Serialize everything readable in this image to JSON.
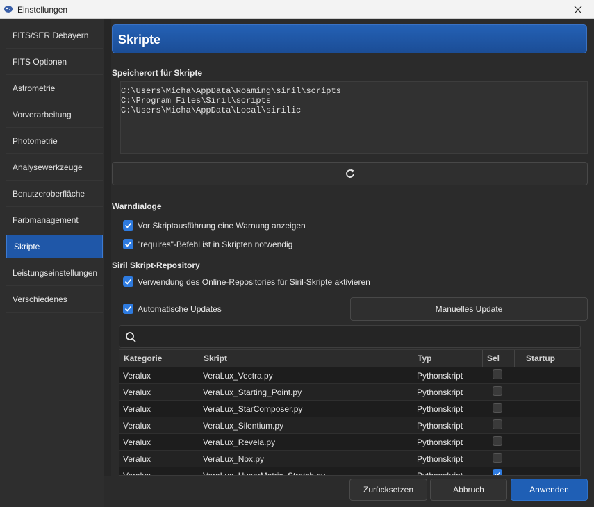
{
  "window": {
    "title": "Einstellungen",
    "app_icon": "siril-icon",
    "close_icon": "close-icon"
  },
  "sidebar": {
    "items": [
      {
        "label": "FITS/SER Debayern"
      },
      {
        "label": "FITS Optionen"
      },
      {
        "label": "Astrometrie"
      },
      {
        "label": "Vorverarbeitung"
      },
      {
        "label": "Photometrie"
      },
      {
        "label": "Analysewerkzeuge"
      },
      {
        "label": "Benutzeroberfläche"
      },
      {
        "label": "Farbmanagement"
      },
      {
        "label": "Skripte"
      },
      {
        "label": "Leistungseinstellungen"
      },
      {
        "label": "Verschiedenes"
      }
    ],
    "selected": "Skripte"
  },
  "page": {
    "header": "Skripte",
    "storage_label": "Speicherort für Skripte",
    "paths": [
      "C:\\Users\\Micha\\AppData\\Roaming\\siril\\scripts",
      "C:\\Program Files\\Siril\\scripts",
      "C:\\Users\\Micha\\AppData\\Local\\sirilic"
    ],
    "refresh_icon": "refresh-icon",
    "warn_label": "Warndialoge",
    "warn_checks": [
      {
        "label": "Vor Skriptausführung eine Warnung anzeigen",
        "checked": true
      },
      {
        "label": "\"requires\"-Befehl ist in Skripten notwendig",
        "checked": true
      }
    ],
    "repo_label": "Siril Skript-Repository",
    "repo_online": {
      "label": "Verwendung des Online-Repositories für Siril-Skripte aktivieren",
      "checked": true
    },
    "auto_updates": {
      "label": "Automatische Updates",
      "checked": true
    },
    "manual_update": "Manuelles Update",
    "search_icon": "search-icon",
    "search_value": ""
  },
  "table": {
    "columns": [
      "Kategorie",
      "Skript",
      "Typ",
      "Sel",
      "Startup"
    ],
    "rows": [
      {
        "kategorie": "Veralux",
        "skript": "VeraLux_Vectra.py",
        "typ": "Pythonskript",
        "sel": false
      },
      {
        "kategorie": "Veralux",
        "skript": "VeraLux_Starting_Point.py",
        "typ": "Pythonskript",
        "sel": false
      },
      {
        "kategorie": "Veralux",
        "skript": "VeraLux_StarComposer.py",
        "typ": "Pythonskript",
        "sel": false
      },
      {
        "kategorie": "Veralux",
        "skript": "VeraLux_Silentium.py",
        "typ": "Pythonskript",
        "sel": false
      },
      {
        "kategorie": "Veralux",
        "skript": "VeraLux_Revela.py",
        "typ": "Pythonskript",
        "sel": false
      },
      {
        "kategorie": "Veralux",
        "skript": "VeraLux_Nox.py",
        "typ": "Pythonskript",
        "sel": false
      },
      {
        "kategorie": "Veralux",
        "skript": "VeraLux_HyperMetric_Stretch.py",
        "typ": "Pythonskript",
        "sel": true
      }
    ]
  },
  "footer": {
    "reset": "Zurücksetzen",
    "cancel": "Abbruch",
    "apply": "Anwenden"
  },
  "colors": {
    "accent": "#1f57a8",
    "checkbox": "#2e7be0",
    "background": "#2b2b2b"
  }
}
